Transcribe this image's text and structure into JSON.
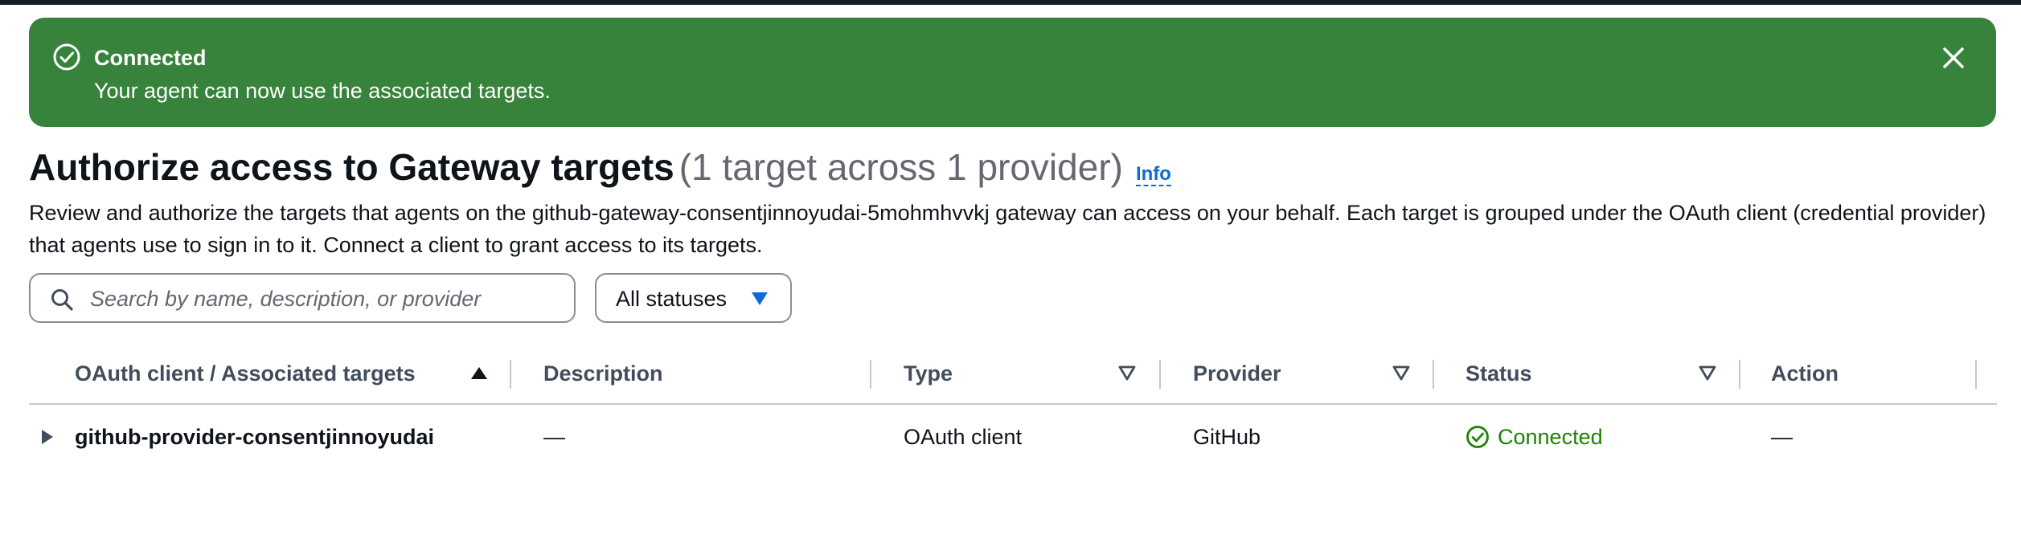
{
  "flash": {
    "title": "Connected",
    "message": "Your agent can now use the associated targets.",
    "icon": "check-circle-icon",
    "close_icon": "close-icon",
    "color": "#37833b"
  },
  "header": {
    "title": "Authorize access to Gateway targets",
    "count": "(1 target across 1 provider)",
    "info_label": "Info"
  },
  "description": "Review and authorize the targets that agents on the github-gateway-consentjinnoyudai-5mohmhvvkj gateway can access on your behalf. Each target is grouped under the OAuth client (credential provider) that agents use to sign in to it. Connect a client to grant access to its targets.",
  "filters": {
    "search_placeholder": "Search by name, description, or provider",
    "search_value": "",
    "status_selected": "All statuses"
  },
  "table": {
    "columns": [
      {
        "label": "OAuth client / Associated targets",
        "sort": "ascending"
      },
      {
        "label": "Description",
        "sort": "none"
      },
      {
        "label": "Type",
        "sort": "sortable"
      },
      {
        "label": "Provider",
        "sort": "sortable"
      },
      {
        "label": "Status",
        "sort": "sortable"
      },
      {
        "label": "Action",
        "sort": "none"
      }
    ],
    "rows": [
      {
        "name": "github-provider-consentjinnoyudai",
        "description": "—",
        "type": "OAuth client",
        "provider": "GitHub",
        "status": "Connected",
        "action": "—"
      }
    ]
  },
  "colors": {
    "accent": "#0f6ad6",
    "success": "#1d8102",
    "flash_bg": "#37833b"
  }
}
